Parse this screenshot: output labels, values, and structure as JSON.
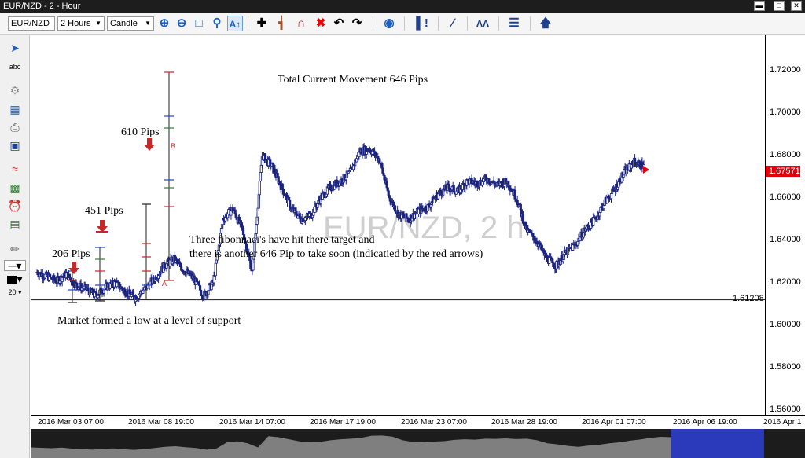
{
  "window": {
    "title": "EUR/NZD - 2 - Hour"
  },
  "toolbar": {
    "symbol": "EUR/NZD",
    "timeframe": "2 Hours",
    "chart_type": "Candle",
    "icons": [
      "zoom-in-icon",
      "zoom-out-icon",
      "zoom-area-icon",
      "zoom-reset-icon",
      "auto-scale-icon",
      "crosshair-icon",
      "magnet-icon",
      "remove-magnet-icon",
      "delete-icon",
      "undo-icon",
      "redo-icon",
      "indicator-icon",
      "show-trades-icon",
      "trendline-icon",
      "drawing-tools-icon",
      "template-icon",
      "upload-icon"
    ]
  },
  "left_panel": {
    "icons": [
      "cursor-icon",
      "text-icon",
      "settings-icon",
      "layout-icon",
      "print-icon",
      "save-icon",
      "indicators-icon",
      "chart-window-icon",
      "alarm-icon",
      "excel-icon",
      "brush-icon",
      "line-style-icon",
      "color-icon"
    ],
    "line_width": "20"
  },
  "chart": {
    "watermark": "EUR/NZD, 2 h",
    "annotations": {
      "total_movement": "Total Current Movement 646 Pips",
      "pips_610": "610 Pips",
      "pips_451": "451 Pips",
      "pips_206": "206 Pips",
      "fib_line1": "Three fibonnaci's have hit there target and",
      "fib_line2": "there is another 646 Pip to take soon (indicatied by the red arrows)",
      "support": "Market formed a low at a level of support",
      "point_a": "A",
      "point_b": "B"
    },
    "support_level": "1.61208",
    "current_price": "1.67571",
    "colors": {
      "candle": "#1a237e",
      "arrow": "#c62828",
      "current_price": "#e3000b",
      "fib_red": "#c62828",
      "fib_blue": "#1a48c8",
      "fib_green": "#2e7d32"
    }
  },
  "chart_data": {
    "type": "candlestick",
    "symbol": "EUR/NZD",
    "ylim": [
      1.56,
      1.73
    ],
    "y_ticks": [
      "1.72000",
      "1.70000",
      "1.68000",
      "1.66000",
      "1.64000",
      "1.62000",
      "1.60000",
      "1.58000",
      "1.56000"
    ],
    "x_ticks": [
      "2016 Mar 03 07:00",
      "2016 Mar 08 19:00",
      "2016 Mar 14 07:00",
      "2016 Mar 17 19:00",
      "2016 Mar 23 07:00",
      "2016 Mar 28 19:00",
      "2016 Apr 01 07:00",
      "2016 Apr 06 19:00",
      "2016 Apr 1"
    ],
    "support_line": 1.61208,
    "last_price": 1.67571,
    "path_closes": [
      1.625,
      1.623,
      1.621,
      1.624,
      1.619,
      1.617,
      1.614,
      1.618,
      1.62,
      1.616,
      1.613,
      1.617,
      1.622,
      1.628,
      1.631,
      1.626,
      1.622,
      1.614,
      1.62,
      1.65,
      1.655,
      1.645,
      1.625,
      1.68,
      1.675,
      1.665,
      1.655,
      1.65,
      1.652,
      1.66,
      1.665,
      1.668,
      1.672,
      1.682,
      1.683,
      1.678,
      1.66,
      1.652,
      1.65,
      1.654,
      1.656,
      1.662,
      1.665,
      1.663,
      1.668,
      1.667,
      1.669,
      1.666,
      1.668,
      1.66,
      1.645,
      1.64,
      1.632,
      1.628,
      1.634,
      1.638,
      1.645,
      1.65,
      1.658,
      1.664,
      1.672,
      1.677,
      1.675
    ]
  },
  "price_axis": {
    "labels": [
      "1.72000",
      "1.70000",
      "1.68000",
      "1.66000",
      "1.64000",
      "1.62000",
      "1.60000",
      "1.58000",
      "1.56000"
    ]
  },
  "time_axis": {
    "labels": [
      "2016 Mar 03 07:00",
      "2016 Mar 08 19:00",
      "2016 Mar 14 07:00",
      "2016 Mar 17 19:00",
      "2016 Mar 23 07:00",
      "2016 Mar 28 19:00",
      "2016 Apr 01 07:00",
      "2016 Apr 06 19:00",
      "2016 Apr 1"
    ]
  }
}
